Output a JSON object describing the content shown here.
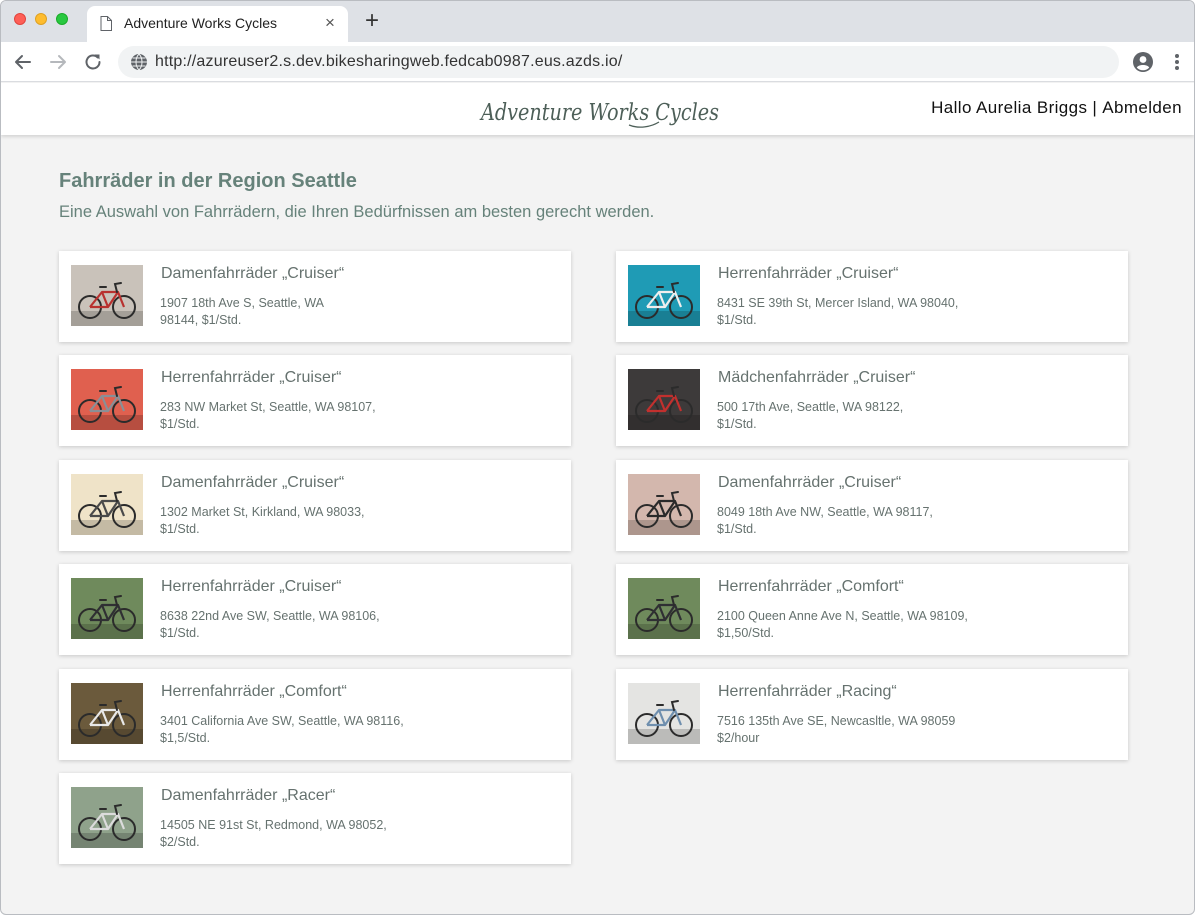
{
  "browser": {
    "tab_title": "Adventure Works Cycles",
    "tab_close": "×",
    "new_tab": "+",
    "url": "http://azureuser2.s.dev.bikesharingweb.fedcab0987.eus.azds.io/"
  },
  "header": {
    "logo_text": "Adventure Works Cycles",
    "greeting": "Hallo Aurelia Briggs",
    "separator": "|",
    "logout": "Abmelden"
  },
  "main": {
    "title": "Fahrräder in der Region Seattle",
    "subtitle": "Eine Auswahl von Fahrrädern, die Ihren Bedürfnissen am besten gerecht werden."
  },
  "bikes": [
    {
      "name": "Damenfahrräder „Cruiser“",
      "address_line1": "1907 18th Ave S, Seattle, WA",
      "address_line2": "98144, $1/Std.",
      "photo": "red-bike-on-gray",
      "bg": "#c9c2ba",
      "frame": "#b8312f"
    },
    {
      "name": "Herrenfahrräder „Cruiser“",
      "address_line1": "8431 SE 39th St, Mercer Island, WA 98040,",
      "address_line2": "$1/Std.",
      "photo": "white-bike-teal-wall",
      "bg": "#1f9bb5",
      "frame": "#eeeeee"
    },
    {
      "name": "Herrenfahrräder „Cruiser“",
      "address_line1": "283 NW Market St, Seattle, WA 98107,",
      "address_line2": "$1/Std.",
      "photo": "gray-bike-red-wall",
      "bg": "#e0604f",
      "frame": "#8a8f96"
    },
    {
      "name": "Mädchenfahrräder „Cruiser“",
      "address_line1": "500 17th Ave, Seattle, WA 98122,",
      "address_line2": "$1/Std.",
      "photo": "red-bike-dark-doors",
      "bg": "#3d3a3a",
      "frame": "#c2302e"
    },
    {
      "name": "Damenfahrräder „Cruiser“",
      "address_line1": "1302 Market St, Kirkland, WA 98033,",
      "address_line2": "$1/Std.",
      "photo": "bike-colorful-mural",
      "bg": "#efe3c8",
      "frame": "#4a4a4a"
    },
    {
      "name": "Damenfahrräder „Cruiser“",
      "address_line1": "8049 18th Ave NW, Seattle, WA 98117,",
      "address_line2": "$1/Std.",
      "photo": "black-bike-pink-wall",
      "bg": "#d3b7ad",
      "frame": "#2a2a2a"
    },
    {
      "name": "Herrenfahrräder „Cruiser“",
      "address_line1": "8638 22nd Ave SW, Seattle, WA 98106,",
      "address_line2": "$1/Std.",
      "photo": "mountain-bike-forest",
      "bg": "#6f8a5c",
      "frame": "#2f2f33"
    },
    {
      "name": "Herrenfahrräder „Comfort“",
      "address_line1": "2100 Queen Anne Ave N, Seattle, WA 98109,",
      "address_line2": "$1,50/Std.",
      "photo": "mountain-bike-forest",
      "bg": "#6f8a5c",
      "frame": "#2f2f33"
    },
    {
      "name": "Herrenfahrräder „Comfort“",
      "address_line1": "3401 California Ave SW, Seattle, WA 98116,",
      "address_line2": "$1,5/Std.",
      "photo": "white-bike-trees",
      "bg": "#6b5a3c",
      "frame": "#e8e8e8"
    },
    {
      "name": "Herrenfahrräder „Racing“",
      "address_line1": "7516 135th Ave SE, Newcasltle, WA 98059",
      "address_line2": "$2/hour",
      "photo": "orange-wheel-racer",
      "bg": "#e4e4e2",
      "frame": "#6f8fae"
    },
    {
      "name": "Damenfahrräder „Racer“",
      "address_line1": "14505 NE 91st St, Redmond, WA 98052,",
      "address_line2": "$2/Std.",
      "photo": "bikes-at-railing",
      "bg": "#8fa28b",
      "frame": "#dcdcdc"
    }
  ],
  "icons": {
    "tab_page": "page-icon",
    "back": "arrow-left-icon",
    "forward": "arrow-right-icon",
    "reload": "reload-icon",
    "site": "globe-icon",
    "account": "account-circle-icon",
    "menu": "more-vert-icon"
  },
  "colors": {
    "accent_text": "#66827a",
    "card_text": "#66726f",
    "tab_strip": "#dee1e6",
    "page_bg": "#f3f3f3"
  }
}
